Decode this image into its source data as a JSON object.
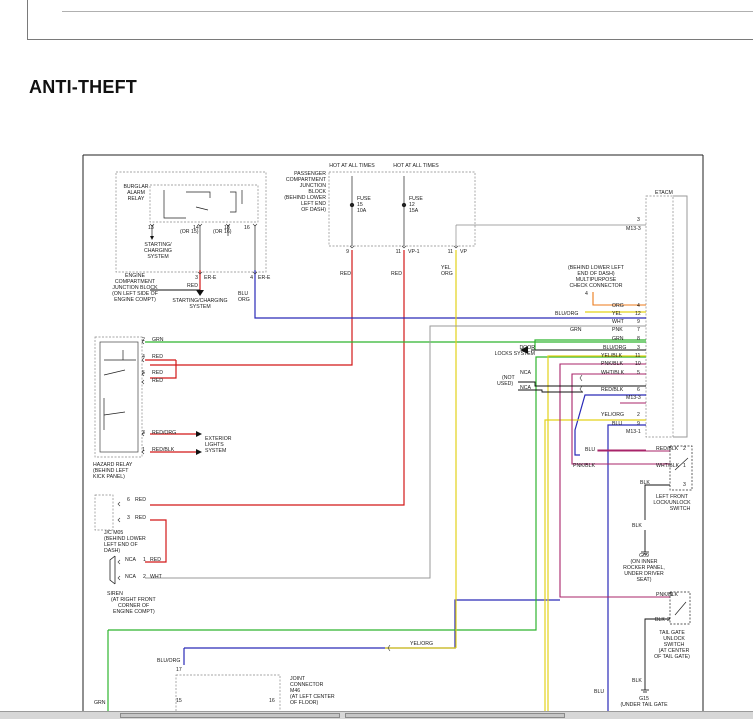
{
  "page": {
    "title": "ANTI-THEFT"
  },
  "colors": {
    "red": "#d21818",
    "blue": "#2a2ab8",
    "green": "#2fb52f",
    "yellow": "#e3d21a",
    "gray": "#9a9a9a",
    "pink": "#a8246a",
    "orange": "#ec7a1a",
    "black": "#111111",
    "dashed": "#888888"
  },
  "labels": {
    "hot1": "HOT AT ALL TIMES",
    "hot2": "HOT AT ALL TIMES",
    "pcjb1": "PASSENGER",
    "pcjb2": "COMPARTMENT",
    "pcjb3": "JUNCTION",
    "pcjb4": "BLOCK",
    "pcjb5": "(BEHIND LOWER",
    "pcjb6": "LEFT END",
    "pcjb7": "OF DASH)",
    "fuse15a": "FUSE",
    "fuse15b": "15",
    "fuse15c": "10A",
    "fuse12a": "FUSE",
    "fuse12b": "12",
    "fuse12c": "15A",
    "pin9": "9",
    "pin11a": "11",
    "pin11b": "11",
    "vp1": "VP-1",
    "vp": "VP",
    "etacm": "ETACM",
    "m133": "M13-3",
    "m133b": "M13-3",
    "m131": "M13-1",
    "pin3etacm": "3",
    "bar1": "BURGLAR",
    "bar2": "ALARM",
    "bar3": "RELAY",
    "p13": "13",
    "p14": "14",
    "p18": "18",
    "p16": "16",
    "or15": "(OR 15)",
    "or16": "(OR 16)",
    "scs1": "STARTING/",
    "scs2": "CHARGING",
    "scs3": "SYSTEM",
    "ecjb1": "ENGINE",
    "ecjb2": "COMPARTMENT",
    "ecjb3": "JUNCTION BLOCK",
    "ecjb4": "(ON LEFT SIDE OF",
    "ecjb5": "ENGINE COMPT)",
    "pin3er": "3",
    "er1": "ER-E",
    "pin4er": "4",
    "er2": "ER-E",
    "red_a": "RED",
    "scs_b": "STARTING/CHARGING",
    "scs_c": "SYSTEM",
    "blu1": "BLU",
    "org1": "ORG",
    "red_b": "RED",
    "red_c": "RED",
    "yel1": "YEL",
    "org2": "ORG",
    "mpc1": "(BEHIND LOWER LEFT",
    "mpc2": "END OF DASH)",
    "mpc3": "MULTIPURPOSE",
    "mpc4": "CHECK CONNECTOR",
    "mpc5": "4",
    "w_org": "ORG",
    "w_yel": "YEL",
    "w_wht": "WHT",
    "w_pnk": "PNK",
    "w_grn": "GRN",
    "w_bluorg": "BLU/ORG",
    "w_yelblk": "YEL/BLK",
    "w_pnkblk": "PNK/BLK",
    "w_whtblk": "WHT/BLK",
    "w_redblk": "RED/BLK",
    "w_yelorg": "YEL/ORG",
    "w_blu": "BLU",
    "n4": "4",
    "n12": "12",
    "n9": "9",
    "n7": "7",
    "n8": "8",
    "n3": "3",
    "n11": "11",
    "n10": "10",
    "n5": "5",
    "n6": "6",
    "n2": "2",
    "n9b": "9",
    "bluorg_l": "BLU/ORG",
    "grn_l": "GRN",
    "door1": "DOOR",
    "door2": "LOCKS SYSTEM",
    "nca1": "NCA",
    "nca2": "NCA",
    "notused1": "(NOT",
    "notused2": "USED)",
    "hz_grn": "GRN",
    "hz_red1": "RED",
    "hz_red2": "RED",
    "hz_redorg": "RED/ORG",
    "hz_redblk": "RED/BLK",
    "hz_p2": "2",
    "hz_p4": "4",
    "hz_p5": "5",
    "hz_p3": "3",
    "hz_p1": "1",
    "ext1": "EXTERIOR",
    "ext2": "LIGHTS",
    "ext3": "SYSTEM",
    "hr1": "HAZARD RELAY",
    "hr2": "(BEHIND LEFT",
    "hr3": "KICK PANEL)",
    "jc_p6": "6",
    "jc_p3": "3",
    "jc_red1": "RED",
    "jc_red2": "RED",
    "jc1": "J/C M05",
    "jc2": "(BEHIND LOWER",
    "jc3": "LEFT END OF",
    "jc4": "DASH)",
    "sir_p1": "1",
    "sir_p2": "2",
    "sir_nca1": "NCA",
    "sir_nca2": "NCA",
    "sir_red": "RED",
    "sir_wht": "WHT",
    "sir1": "SIREN",
    "sir2": "(AT RIGHT FRONT",
    "sir3": "CORNER OF",
    "sir4": "ENGINE COMPT)",
    "lf_redblk": "RED/BLK",
    "lf_whtblk": "WHT/BLK",
    "lf_blk": "BLK",
    "lf_blu": "BLU",
    "lf_pnkblk": "PNK/BLK",
    "lf_p2": "2",
    "lf_p1": "1",
    "lf_p3": "3",
    "lf1": "LEFT FRONT",
    "lf2": "LOCK/UNLOCK",
    "lf3": "SWITCH",
    "g09_blk": "BLK",
    "g09a": "G09",
    "g09b": "(ON INNER",
    "g09c": "ROCKER PANEL,",
    "g09d": "UNDER DRIVER",
    "g09e": "SEAT)",
    "tg_pnkblk": "PNK/BLK",
    "tg_blk": "BLK",
    "tg_p1": "1",
    "tg_p2": "2",
    "tg1": "TAIL GATE",
    "tg2": "UNLOCK",
    "tg3": "SWITCH",
    "tg4": "(AT CENTER",
    "tg5": "OF TAIL GATE)",
    "g15_blk": "BLK",
    "g15a": "G15",
    "g15b": "(UNDER TAIL GATE",
    "yelorg_b": "YEL/ORG",
    "bluorg_b": "BLU/ORG",
    "p17": "17",
    "p15": "15",
    "p16b": "16",
    "jcm1": "JOINT",
    "jcm2": "CONNECTOR",
    "jcm3": "M46",
    "jcm4": "(AT LEFT CENTER",
    "jcm5": "OF FLOOR)",
    "blu_bot": "BLU",
    "grn_bot": "GRN"
  }
}
